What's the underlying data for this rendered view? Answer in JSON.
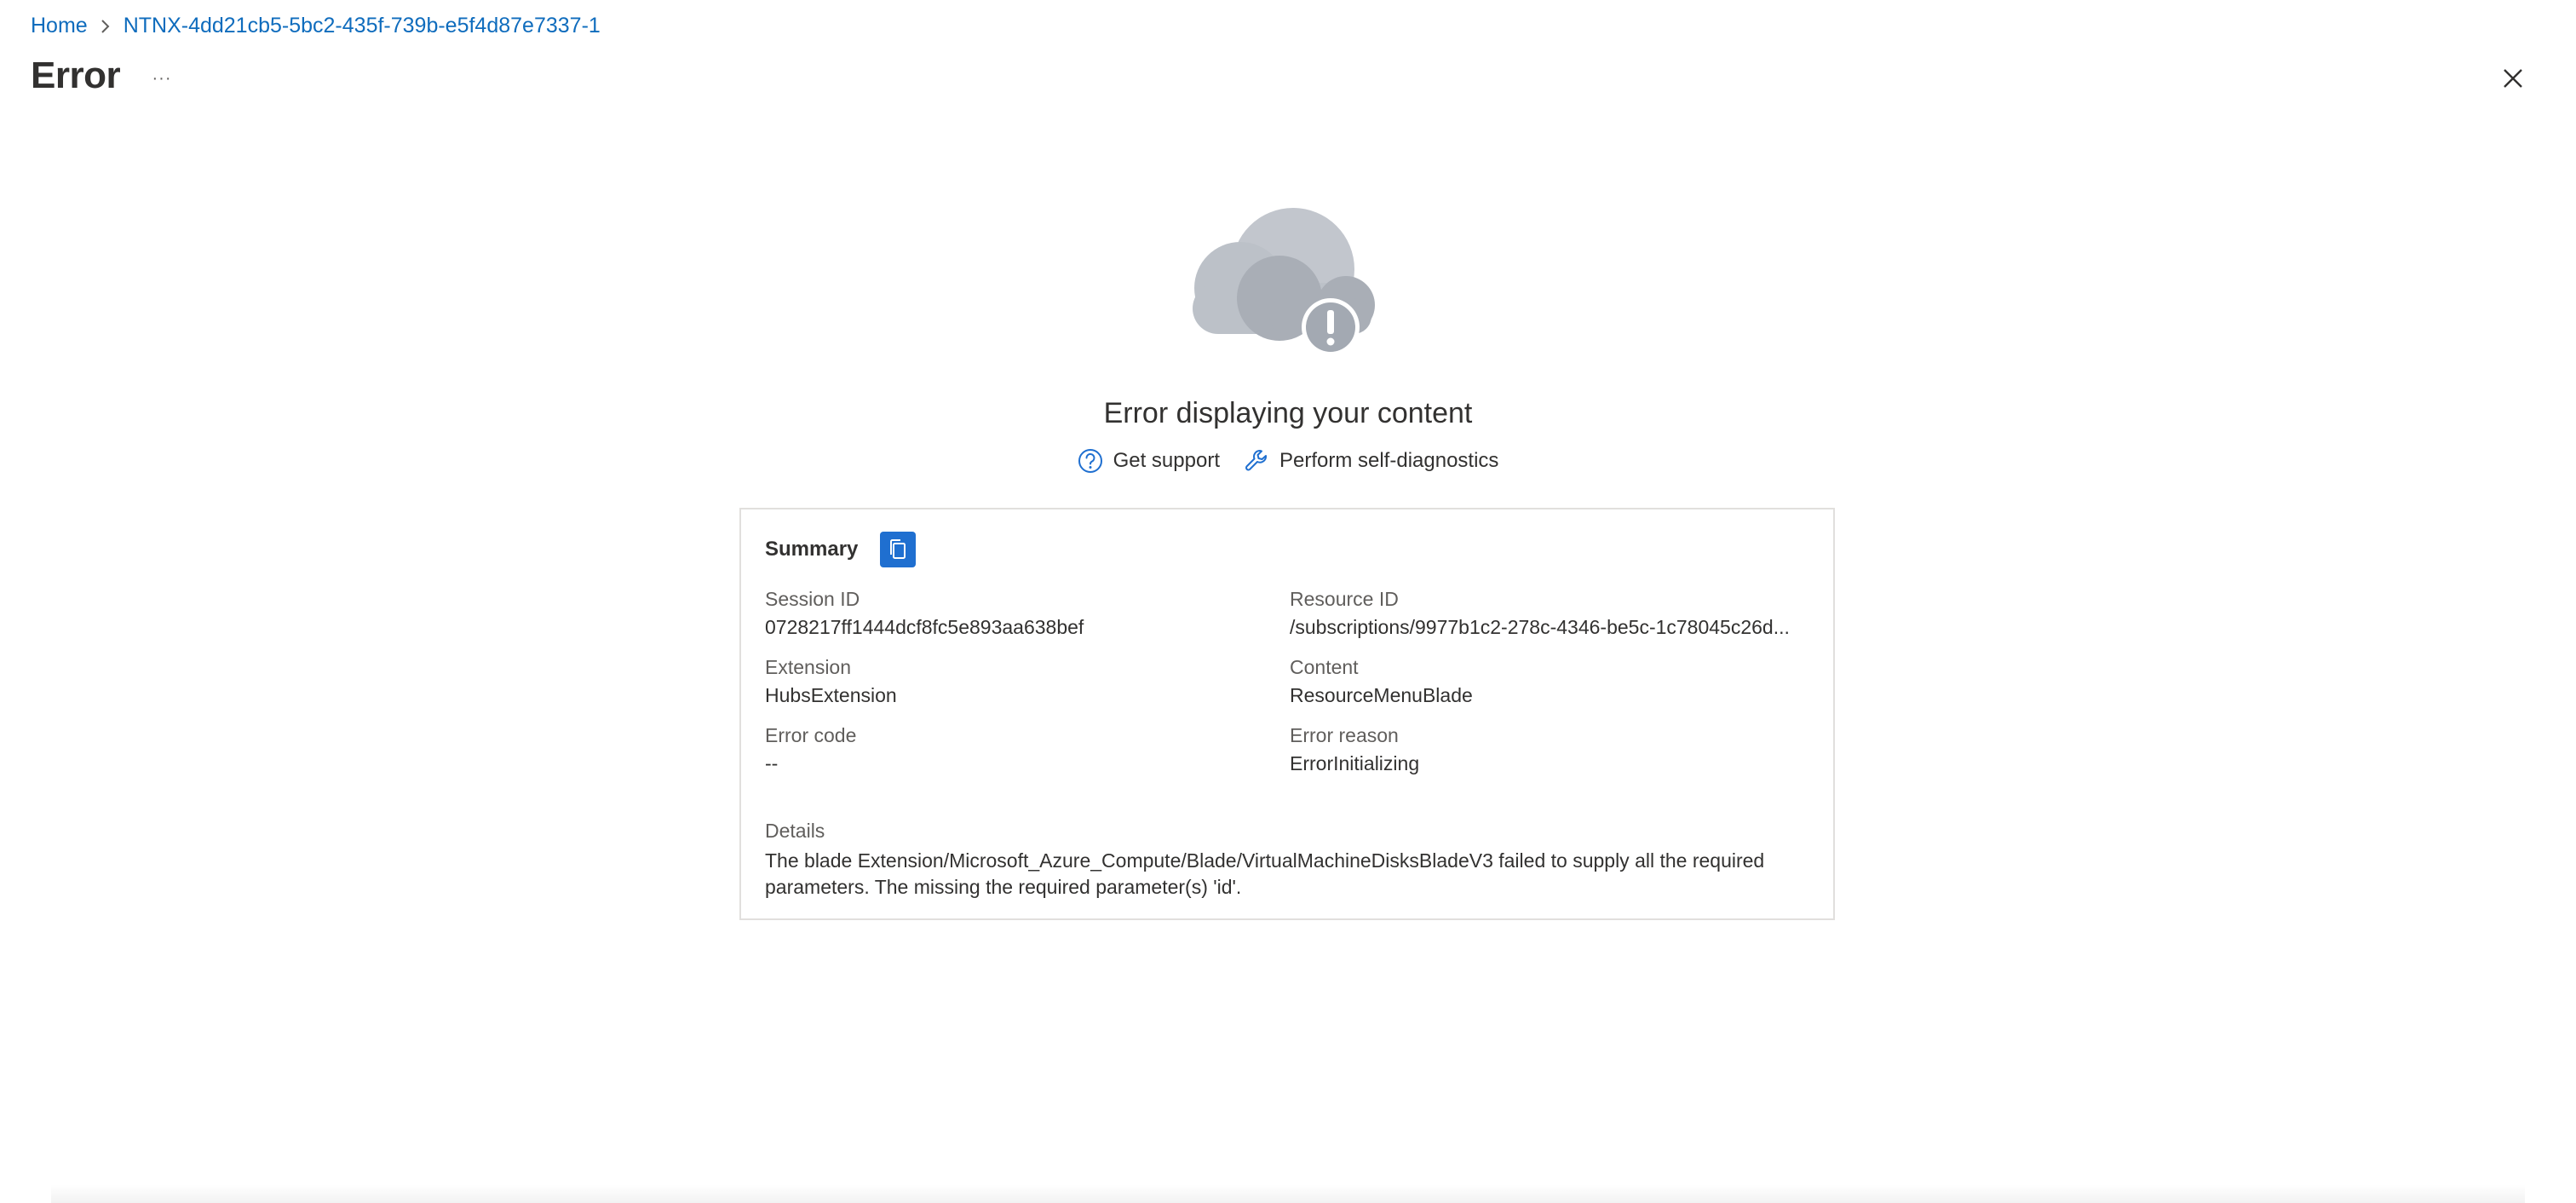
{
  "breadcrumb": {
    "home": "Home",
    "current": "NTNX-4dd21cb5-5bc2-435f-739b-e5f4d87e7337-1"
  },
  "header": {
    "title": "Error",
    "more_label": "···"
  },
  "main": {
    "heading": "Error displaying your content",
    "actions": {
      "support": "Get support",
      "diagnostics": "Perform self-diagnostics"
    }
  },
  "summary": {
    "label": "Summary",
    "fields": {
      "session_id": {
        "label": "Session ID",
        "value": "0728217ff1444dcf8fc5e893aa638bef"
      },
      "resource_id": {
        "label": "Resource ID",
        "value": "/subscriptions/9977b1c2-278c-4346-be5c-1c78045c26d..."
      },
      "extension": {
        "label": "Extension",
        "value": "HubsExtension"
      },
      "content": {
        "label": "Content",
        "value": "ResourceMenuBlade"
      },
      "error_code": {
        "label": "Error code",
        "value": "--"
      },
      "error_reason": {
        "label": "Error reason",
        "value": "ErrorInitializing"
      }
    },
    "details": {
      "label": "Details",
      "value": "The blade Extension/Microsoft_Azure_Compute/Blade/VirtualMachineDisksBladeV3 failed to supply all the required parameters. The missing the required parameter(s) 'id'."
    }
  },
  "icons": {
    "chevron": "chevron-right-icon",
    "close": "close-icon",
    "cloud": "cloud-error-icon",
    "help": "question-circle-icon",
    "wrench": "wrench-icon",
    "copy": "copy-icon"
  },
  "colors": {
    "link": "#0f6cbd",
    "copy_button": "#1f6fd0",
    "cloud_light": "#b9bec6",
    "cloud_dark": "#a3a9b2"
  }
}
